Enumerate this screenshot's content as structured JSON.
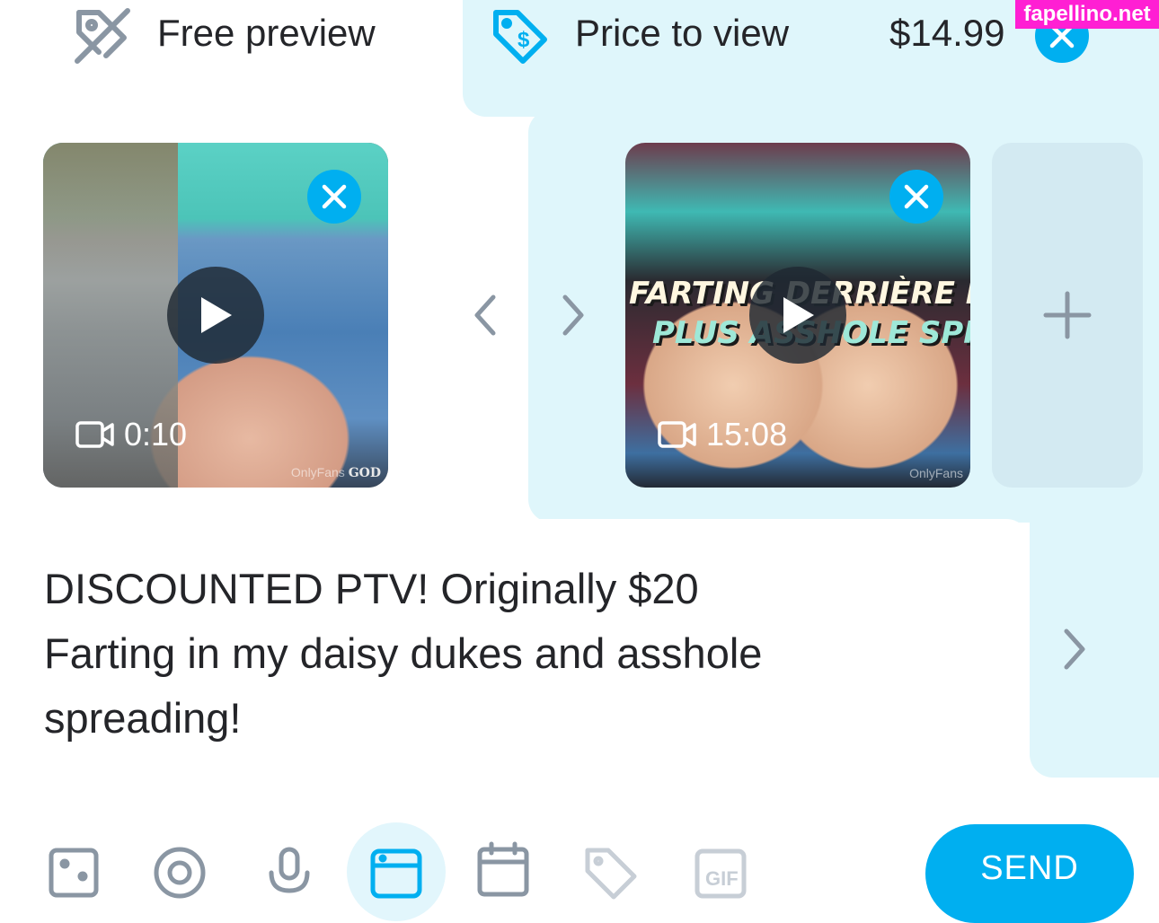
{
  "colors": {
    "accent": "#00aff0",
    "ptv_background": "#dff6fb",
    "text": "#242529",
    "icon_gray": "#8a96a3",
    "badge": "#ff1fd3"
  },
  "tabs": {
    "free_preview": {
      "label": "Free preview",
      "icon": "tag-off-icon"
    },
    "price_to_view": {
      "label": "Price to view",
      "icon": "price-tag-icon",
      "price": "$14.99"
    }
  },
  "media": {
    "free": {
      "duration": "0:10",
      "watermark": "OnlyFans",
      "overlay": "GOD"
    },
    "ptv": {
      "duration": "15:08",
      "watermark": "OnlyFans",
      "title_line_1": "FARTING DERRIÈRE IN",
      "title_line_2": "PLUS ASSHOLE SPRE"
    }
  },
  "message": {
    "line_1": "DISCOUNTED PTV! Originally $20",
    "line_2": "Farting in my daisy dukes and asshole",
    "line_3": "spreading!"
  },
  "toolbar": {
    "icons": [
      "image-icon",
      "vault-icon",
      "microphone-icon",
      "media-vault-icon",
      "calendar-icon",
      "price-tag-icon",
      "gif-icon"
    ],
    "send_label": "SEND"
  },
  "site_badge": "fapellino.net"
}
